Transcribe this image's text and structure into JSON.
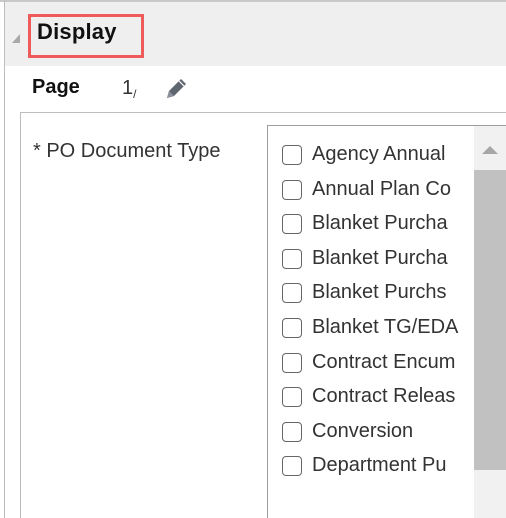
{
  "header": {
    "title": "Display"
  },
  "page_row": {
    "label": "Page",
    "numerator": "1",
    "denominator": "/",
    "edit_icon": "pencil-icon"
  },
  "field": {
    "label": "* PO Document Type",
    "options": [
      "Agency Annual",
      "Annual Plan Co",
      "Blanket Purcha",
      "Blanket Purcha",
      "Blanket Purchs",
      "Blanket TG/EDA",
      "Contract Encum",
      "Contract Releas",
      "Conversion",
      "Department Pu"
    ]
  },
  "icons": {
    "collapse": "collapse-triangle-icon",
    "scroll_up": "scroll-up-arrow-icon"
  },
  "colors": {
    "highlight_box": "#ef5a5a",
    "header_bg": "#efefef"
  }
}
